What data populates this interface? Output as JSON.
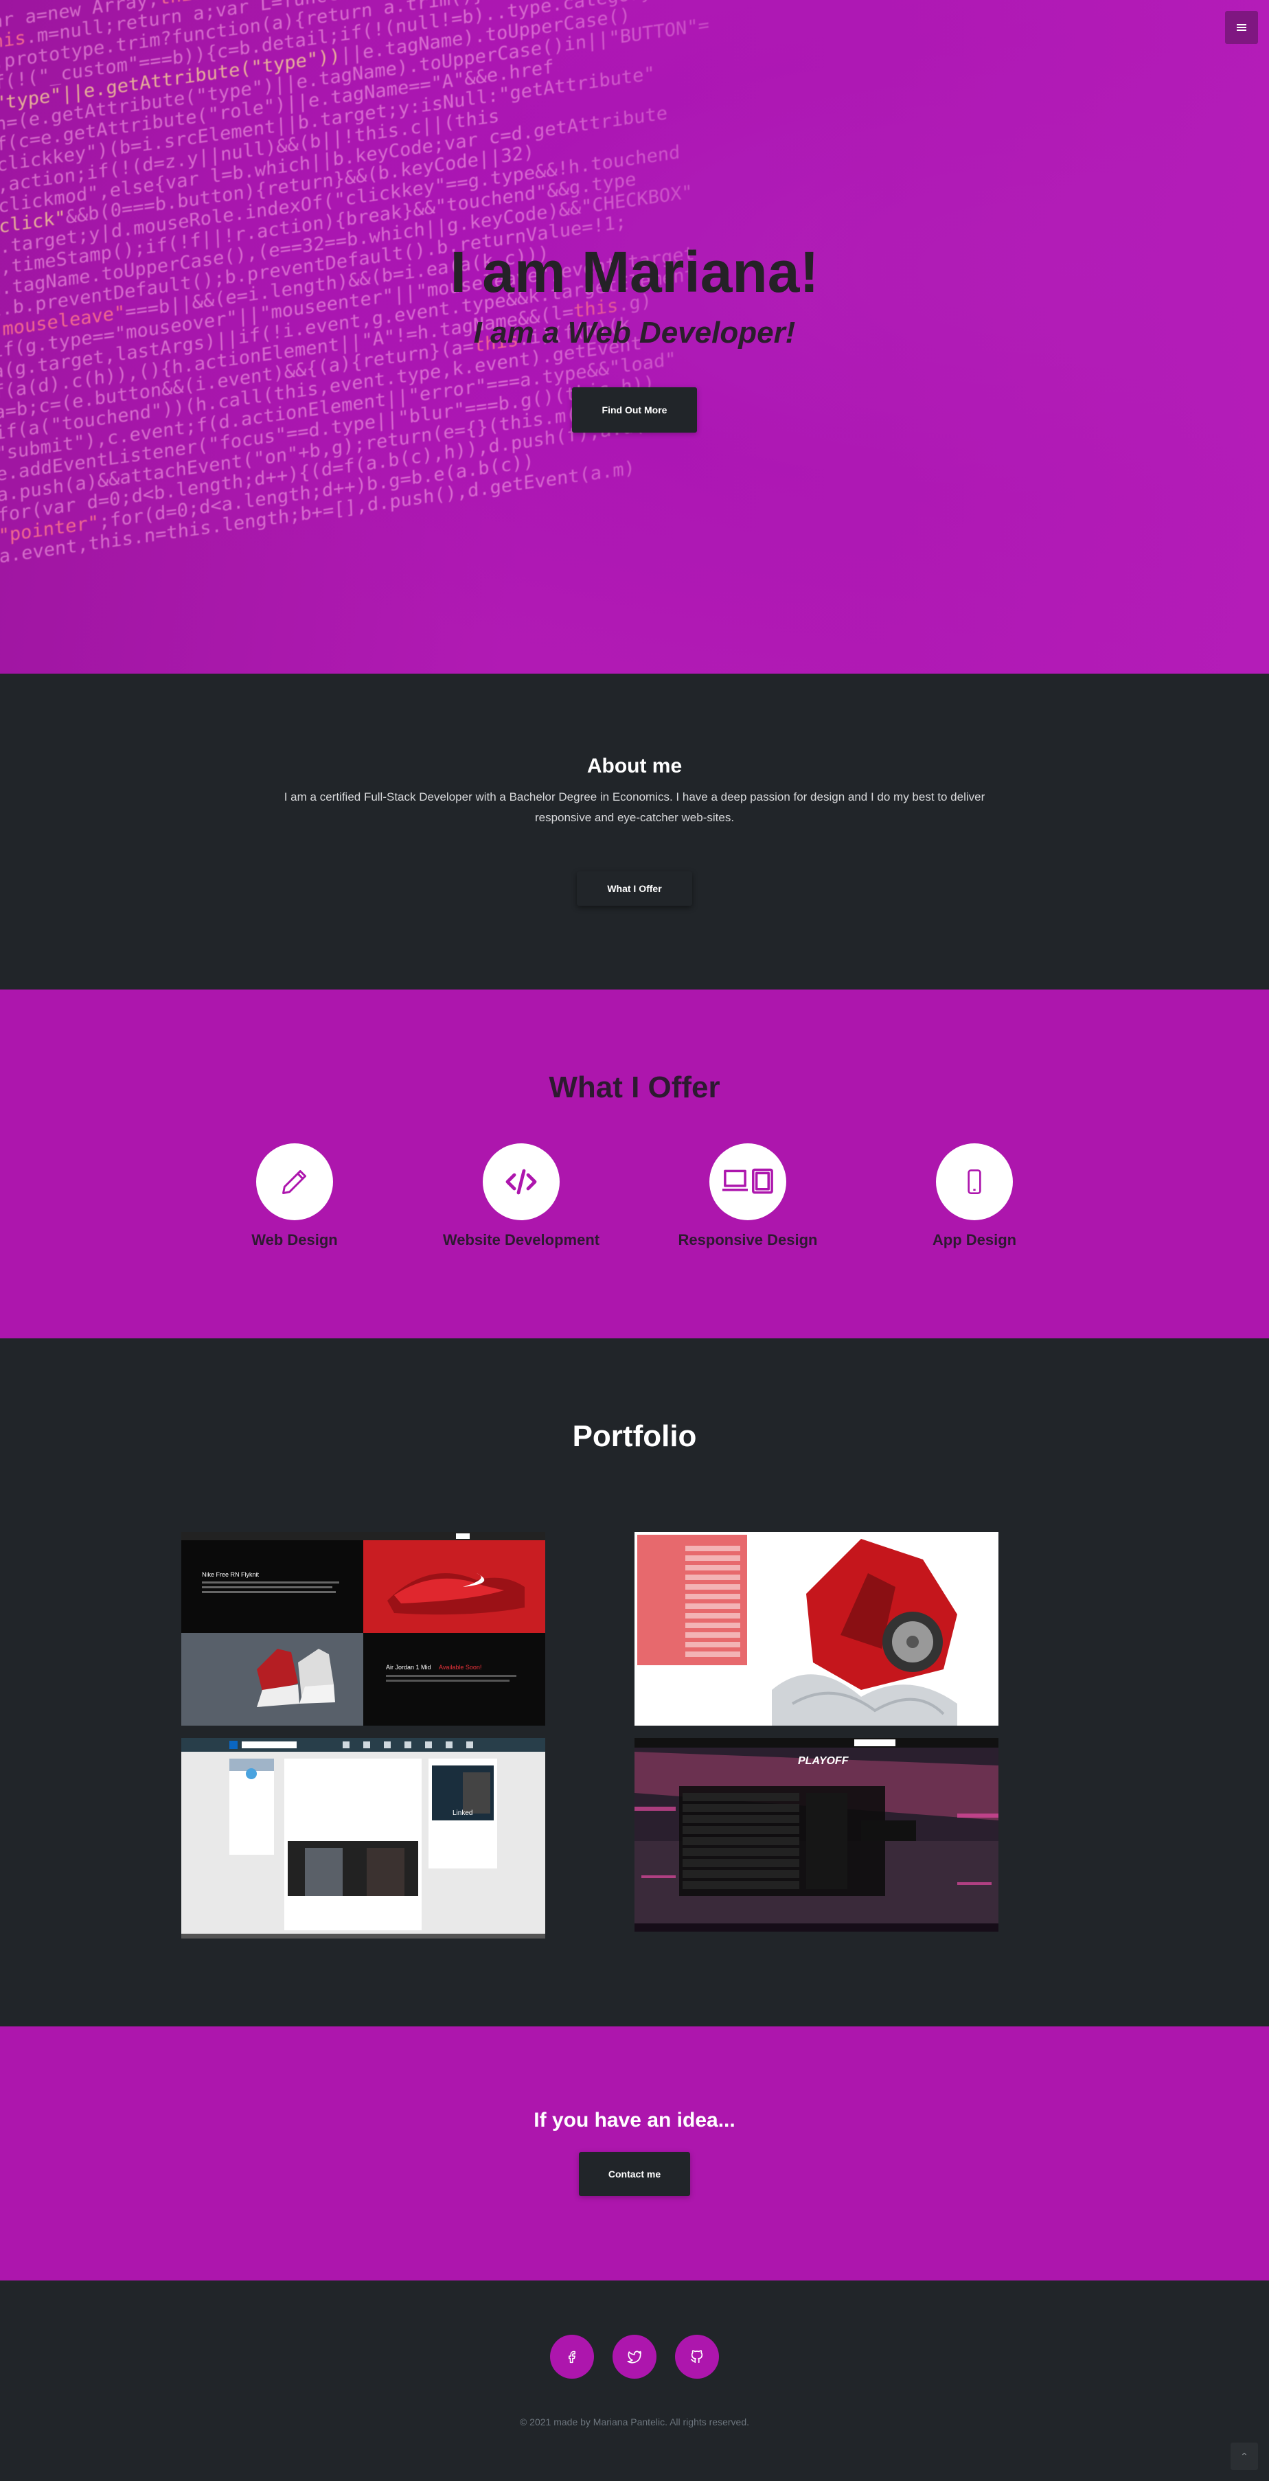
{
  "header": {
    "menu_icon": "hamburger-icon"
  },
  "hero": {
    "title": "I am Mariana!",
    "subtitle": "I am a Web Developer!",
    "cta_label": "Find Out More"
  },
  "about": {
    "heading": "About me",
    "text": "I am a certified Full-Stack Developer with a Bachelor Degree in Economics. I have a deep passion for design and I do my best to deliver responsive and eye-catcher web-sites.",
    "button_label": "What I Offer"
  },
  "offer": {
    "heading": "What I Offer",
    "services": [
      {
        "label": "Web Design",
        "icon": "pencil-icon"
      },
      {
        "label": "Website Development",
        "icon": "code-icon"
      },
      {
        "label": "Responsive Design",
        "icon": "laptop-tablet-icon"
      },
      {
        "label": "App Design",
        "icon": "mobile-icon"
      }
    ]
  },
  "portfolio": {
    "heading": "Portfolio",
    "items": [
      {
        "name": "nike-shoe-store",
        "caption_1": "Nike Free RN Flyknit",
        "caption_2": "Air Jordan 1 Mid",
        "caption_3": "Available Soon!"
      },
      {
        "name": "car-registration-form"
      },
      {
        "name": "linkedin-clone"
      },
      {
        "name": "playoff-basketball",
        "title": "PLAYOFF"
      }
    ]
  },
  "cta": {
    "heading": "If you have an idea...",
    "button_label": "Contact me"
  },
  "footer": {
    "social": [
      {
        "name": "facebook",
        "icon": "facebook-icon"
      },
      {
        "name": "twitter",
        "icon": "twitter-icon"
      },
      {
        "name": "github",
        "icon": "github-icon"
      }
    ],
    "copyright": "© 2021 made by Mariana Pantelic. All rights reserved.",
    "to_top_icon": "chevron-up-icon"
  },
  "colors": {
    "accent": "#ad16ad",
    "dark": "#212529",
    "white": "#ffffff"
  }
}
